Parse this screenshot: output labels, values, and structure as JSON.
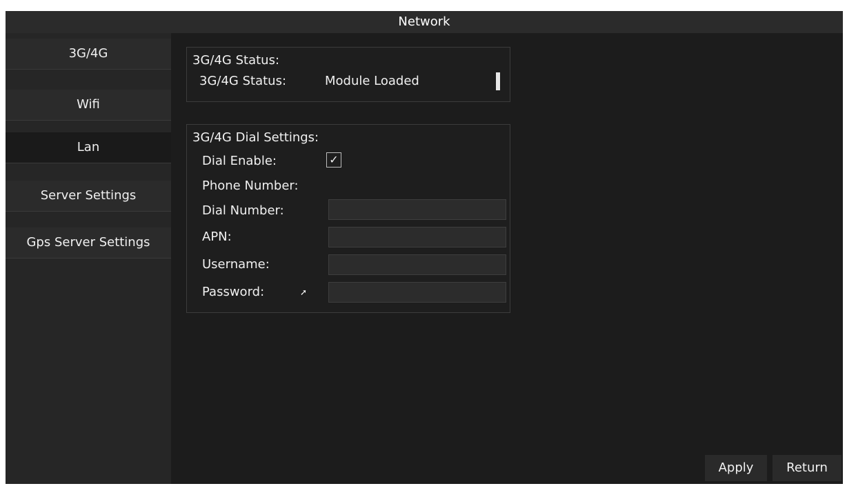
{
  "window": {
    "title": "Network"
  },
  "sidebar": {
    "items": [
      {
        "label": "3G/4G"
      },
      {
        "label": "Wifi"
      },
      {
        "label": "Lan"
      },
      {
        "label": "Server Settings"
      },
      {
        "label": "Gps Server Settings"
      }
    ]
  },
  "status_section": {
    "title": "3G/4G Status:",
    "status_label": "3G/4G Status:",
    "status_value": "Module Loaded"
  },
  "dial_section": {
    "title": "3G/4G Dial Settings:",
    "dial_enable_label": "Dial Enable:",
    "dial_enable_checked": true,
    "phone_number_label": "Phone Number:",
    "dial_number_label": "Dial Number:",
    "dial_number_value": "",
    "apn_label": "APN:",
    "apn_value": "",
    "username_label": "Username:",
    "username_value": "",
    "password_label": "Password:",
    "password_value": ""
  },
  "buttons": {
    "apply": "Apply",
    "return": "Return"
  },
  "icons": {
    "checkbox": "checkmark-icon"
  }
}
